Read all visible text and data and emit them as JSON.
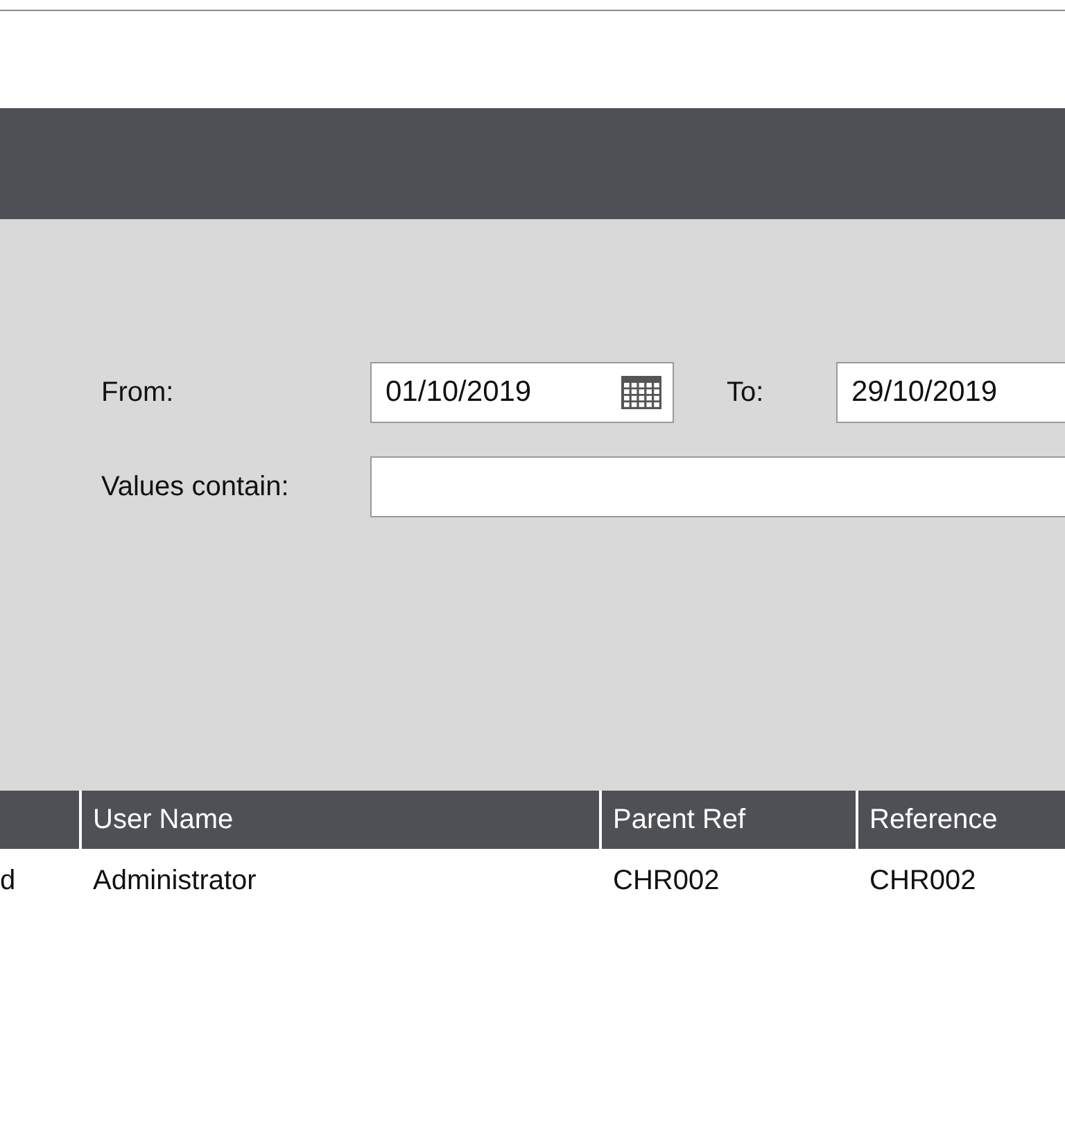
{
  "filter": {
    "from_label": "From:",
    "from_value": "01/10/2019",
    "to_label": "To:",
    "to_value": "29/10/2019",
    "values_label": "Values contain:"
  },
  "table": {
    "columns": [
      "",
      "User Name",
      "Parent Ref",
      "Reference"
    ],
    "rows": [
      {
        "cells": [
          "d",
          "Administrator",
          "CHR002",
          "CHR002"
        ]
      }
    ]
  }
}
